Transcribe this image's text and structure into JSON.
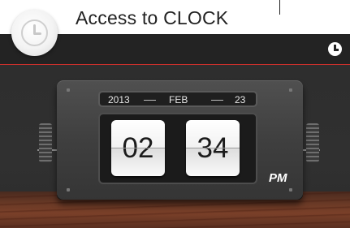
{
  "callout": {
    "text": "Access to CLOCK"
  },
  "icons": {
    "app_icon": "clock-icon",
    "header_icon": "clock-icon"
  },
  "clock": {
    "date": {
      "year": "2013",
      "month": "FEB",
      "day": "23"
    },
    "hour": "02",
    "minute": "34",
    "meridiem": "PM"
  },
  "colors": {
    "header_accent": "#c9302c",
    "background": "#2a2a2a"
  }
}
